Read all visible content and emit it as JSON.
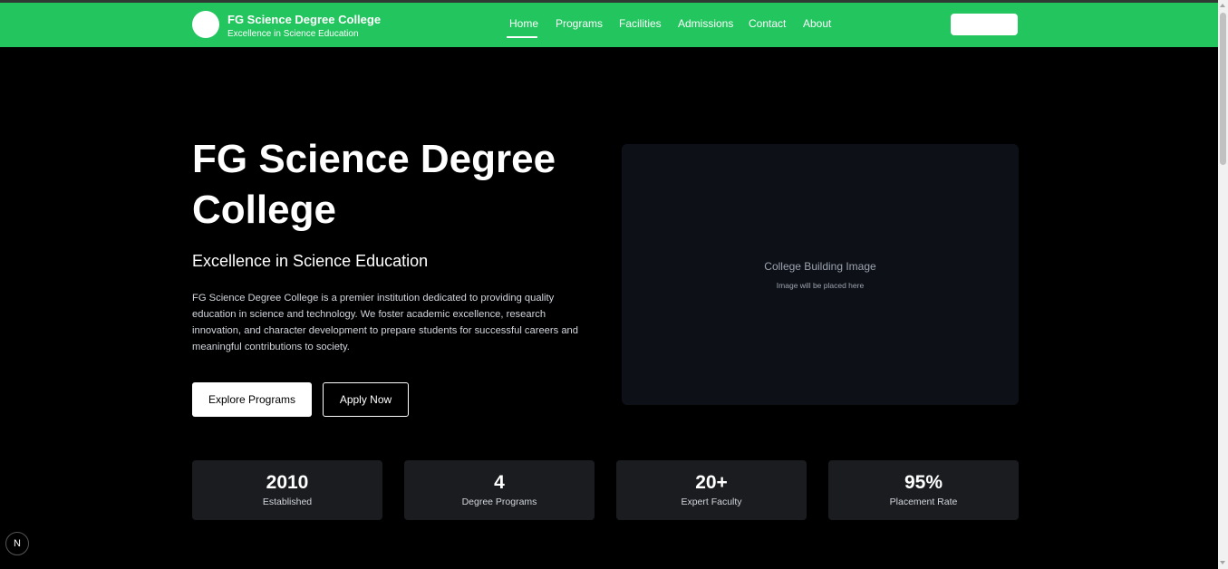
{
  "header": {
    "brand_title": "FG Science Degree College",
    "brand_subtitle": "Excellence in Science Education",
    "nav": [
      {
        "label": "Home"
      },
      {
        "label": "Programs"
      },
      {
        "label": "Facilities"
      },
      {
        "label": "Admissions"
      },
      {
        "label": "Contact"
      },
      {
        "label": "About"
      }
    ],
    "active_nav": "Home"
  },
  "hero": {
    "title": "FG Science Degree College",
    "subtitle": "Excellence in Science Education",
    "description": "FG Science Degree College is a premier institution dedicated to providing quality education in science and technology. We foster academic excellence, research innovation, and character development to prepare students for successful careers and meaningful contributions to society.",
    "primary_button": "Explore Programs",
    "secondary_button": "Apply Now",
    "image_placeholder": {
      "title": "College Building Image",
      "subtitle": "Image will be placed here"
    }
  },
  "stats": [
    {
      "value": "2010",
      "label": "Established"
    },
    {
      "value": "4",
      "label": "Degree Programs"
    },
    {
      "value": "20+",
      "label": "Expert Faculty"
    },
    {
      "value": "95%",
      "label": "Placement Rate"
    }
  ],
  "dev_badge": "N",
  "colors": {
    "header_bg": "#22c55e",
    "page_bg": "#000000",
    "card_bg": "#0d1117",
    "stat_bg": "#1a1c20"
  }
}
